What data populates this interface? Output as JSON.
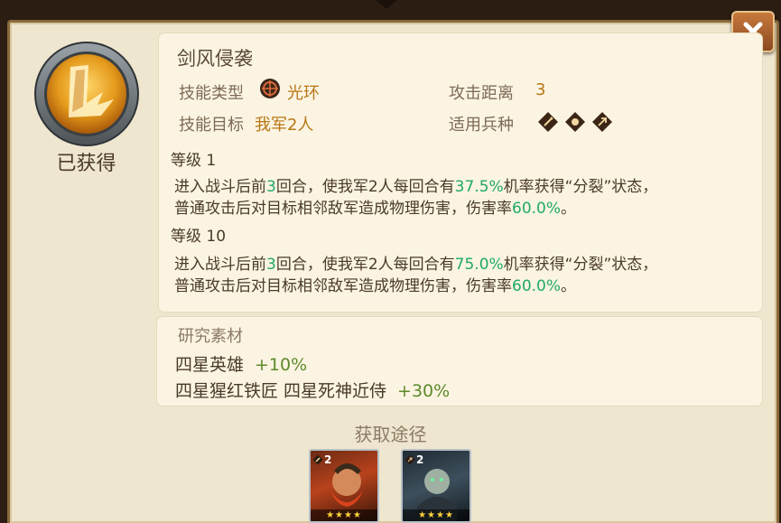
{
  "skill": {
    "name": "剑风侵袭",
    "status": "已获得",
    "type_label": "技能类型",
    "type_value": "光环",
    "range_label": "攻击距离",
    "range_value": "3",
    "target_label": "技能目标",
    "target_value": "我军2人",
    "troops_label": "适用兵种",
    "troop_icons": [
      "sword-troop-icon",
      "fist-troop-icon",
      "bow-troop-icon"
    ]
  },
  "levels": [
    {
      "label": "等级",
      "level": "1",
      "line1": {
        "a": "进入战斗后前",
        "b": "3",
        "c": "回合，使我军2人每回合有",
        "d": "37.5%",
        "e": "机率获得“分裂”状态，"
      },
      "line2": {
        "a": "普通攻击后对目标相邻敌军造成物理伤害，伤害率",
        "b": "60.0%",
        "c": "。"
      }
    },
    {
      "label": "等级",
      "level": "10",
      "line1": {
        "a": "进入战斗后前",
        "b": "3",
        "c": "回合，使我军2人每回合有",
        "d": "75.0%",
        "e": "机率获得“分裂”状态，"
      },
      "line2": {
        "a": "普通攻击后对目标相邻敌军造成物理伤害，伤害率",
        "b": "60.0%",
        "c": "。"
      }
    }
  ],
  "research": {
    "title": "研究素材",
    "items": [
      {
        "names": "四星英雄",
        "bonus": "+10%"
      },
      {
        "names": "四星猩红铁匠 四星死神近侍",
        "bonus": "+30%"
      }
    ]
  },
  "obtain": {
    "title": "获取途径",
    "heroes": [
      {
        "level": "2",
        "stars": "★★★★",
        "icon": "sword-icon"
      },
      {
        "level": "2",
        "stars": "★★★★",
        "icon": "bow-icon"
      }
    ]
  },
  "colors": {
    "highlight": "#21a86b",
    "accent": "#b87614",
    "bonus": "#5d8a2a"
  }
}
